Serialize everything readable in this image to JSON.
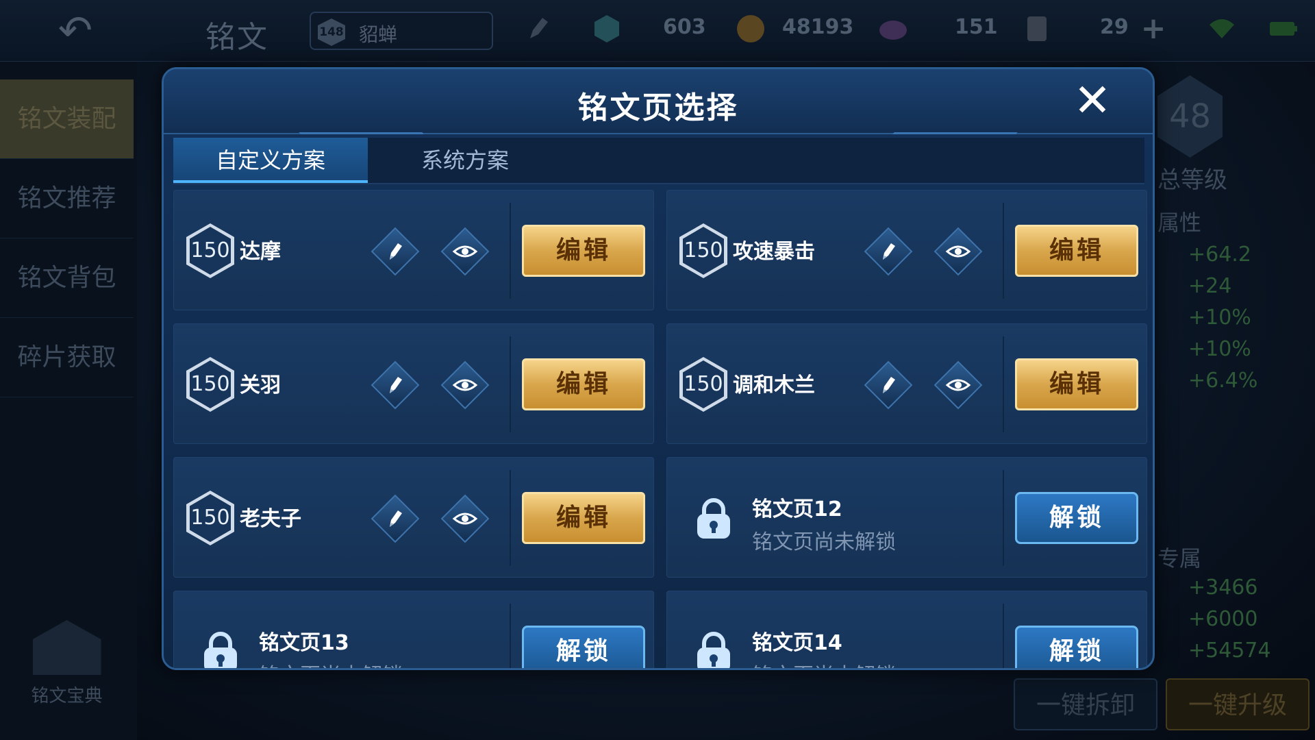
{
  "screen_title": "铭文",
  "hero": {
    "level": "148",
    "name": "貂蝉"
  },
  "resources": [
    {
      "icon": "crystal-icon",
      "value": "603"
    },
    {
      "icon": "gold-coin-icon",
      "value": "48193"
    },
    {
      "icon": "gem-icon",
      "value": "151"
    },
    {
      "icon": "scroll-icon",
      "value": "29"
    }
  ],
  "sidebar": {
    "items": [
      {
        "label": "铭文装配"
      },
      {
        "label": "铭文推荐"
      },
      {
        "label": "铭文背包"
      },
      {
        "label": "碎片获取"
      }
    ],
    "codex_label": "铭文宝典"
  },
  "background_panel": {
    "total_level_value": "48",
    "total_level_label": "总等级",
    "attr_label": "属性",
    "attr_values": [
      "+64.2",
      "+24",
      "+10%",
      "+10%",
      "+6.4%"
    ],
    "exclusive_label": "专属",
    "exclusive_values": [
      "+3466",
      "+6000",
      "+54574"
    ],
    "btn_disassemble": "一键拆卸",
    "btn_upgrade": "一键升级"
  },
  "modal": {
    "title": "铭文页选择",
    "tabs": [
      {
        "label": "自定义方案",
        "active": true
      },
      {
        "label": "系统方案",
        "active": false
      }
    ],
    "pages": [
      {
        "level": "150",
        "name": "达摩",
        "button": "编辑"
      },
      {
        "level": "150",
        "name": "攻速暴击",
        "button": "编辑"
      },
      {
        "level": "150",
        "name": "关羽",
        "button": "编辑"
      },
      {
        "level": "150",
        "name": "调和木兰",
        "button": "编辑"
      },
      {
        "level": "150",
        "name": "老夫子",
        "button": "编辑"
      }
    ],
    "locked_pages": [
      {
        "name": "铭文页12",
        "subtitle": "铭文页尚未解锁",
        "button": "解锁"
      },
      {
        "name": "铭文页13",
        "subtitle": "铭文页尚未解锁",
        "button": "解锁"
      },
      {
        "name": "铭文页14",
        "subtitle": "铭文页尚未解锁",
        "button": "解锁"
      }
    ]
  },
  "colors": {
    "gold_button": "#d9a64c",
    "blue_button": "#2d78c4",
    "active_tab": "#1f5c98",
    "modal_bg": "#13315a"
  }
}
